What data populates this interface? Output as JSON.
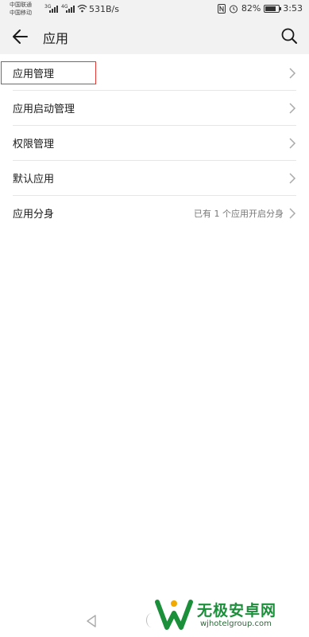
{
  "status_bar": {
    "carrier1": "中国联通",
    "carrier2": "中国移动",
    "net1": "3G",
    "net2": "4G",
    "speed": "531B/s",
    "battery": "82%",
    "battery_level": 0.82,
    "time": "3:53"
  },
  "header": {
    "title": "应用"
  },
  "list": {
    "items": [
      {
        "label": "应用管理",
        "value": ""
      },
      {
        "label": "应用启动管理",
        "value": ""
      },
      {
        "label": "权限管理",
        "value": ""
      },
      {
        "label": "默认应用",
        "value": ""
      },
      {
        "label": "应用分身",
        "value": "已有 1 个应用开启分身"
      }
    ]
  },
  "watermark": {
    "name": "无极安卓网",
    "url": "wjhotelgroup.com"
  }
}
